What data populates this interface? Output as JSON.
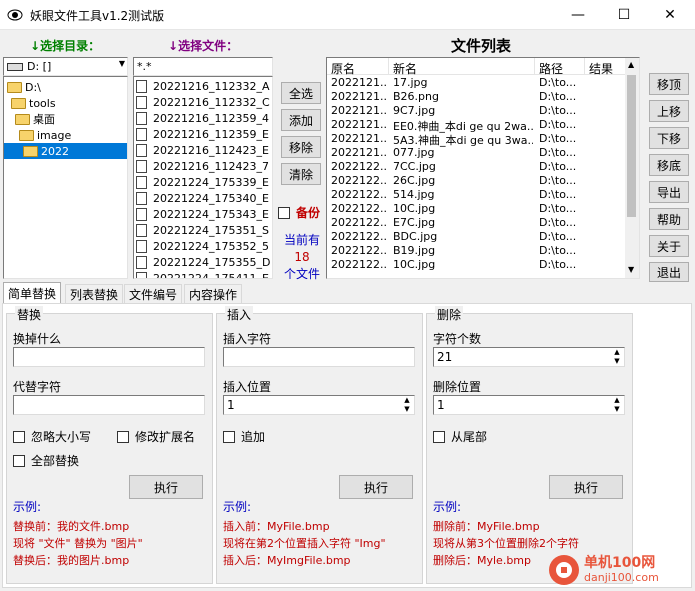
{
  "window": {
    "title": "妖眼文件工具v1.2测试版",
    "min": "—",
    "max": "☐",
    "close": "✕"
  },
  "labels": {
    "select_dir": "选择目录：",
    "select_file": "选择文件：",
    "file_list": "文件列表"
  },
  "drive": {
    "value": "D: []"
  },
  "tree": [
    "D:\\",
    "tools",
    "桌面",
    "image",
    "2022"
  ],
  "filter": {
    "value": "*.*"
  },
  "files": [
    "20221216_112332_A",
    "20221216_112332_C",
    "20221216_112359_4",
    "20221216_112359_E",
    "20221216_112423_E",
    "20221216_112423_7",
    "20221224_175339_E",
    "20221224_175340_E",
    "20221224_175343_E",
    "20221224_175351_S",
    "20221224_175352_5",
    "20221224_175355_D",
    "20221224_175411_E"
  ],
  "mid_buttons": {
    "select_all": "全选",
    "add": "添加",
    "remove": "移除",
    "clear": "清除"
  },
  "backup": {
    "label": "备份"
  },
  "count": {
    "line1": "当前有",
    "line2": "18",
    "line3": "个文件"
  },
  "table": {
    "headers": [
      "原名",
      "新名",
      "路径",
      "结果"
    ],
    "rows": [
      [
        "2022121...",
        "17.jpg",
        "D:\\to..."
      ],
      [
        "2022121...",
        "B26.png",
        "D:\\to..."
      ],
      [
        "2022121...",
        "9C7.jpg",
        "D:\\to..."
      ],
      [
        "2022121...",
        "EE0.神曲_本di ge qu 2wa...",
        "D:\\to..."
      ],
      [
        "2022121...",
        "5A3.神曲_本di ge qu 3wa...",
        "D:\\to..."
      ],
      [
        "2022121...",
        "077.jpg",
        "D:\\to..."
      ],
      [
        "2022122...",
        "7CC.jpg",
        "D:\\to..."
      ],
      [
        "2022122...",
        "26C.jpg",
        "D:\\to..."
      ],
      [
        "2022122...",
        "514.jpg",
        "D:\\to..."
      ],
      [
        "2022122...",
        "10C.jpg",
        "D:\\to..."
      ],
      [
        "2022122...",
        "E7C.jpg",
        "D:\\to..."
      ],
      [
        "2022122...",
        "BDC.jpg",
        "D:\\to..."
      ],
      [
        "2022122...",
        "B19.jpg",
        "D:\\to..."
      ],
      [
        "2022122...",
        "10C.jpg",
        "D:\\to..."
      ]
    ]
  },
  "right_buttons": {
    "top": "移顶",
    "up": "上移",
    "down": "下移",
    "bottom": "移底",
    "export": "导出",
    "help": "帮助",
    "about": "关于",
    "exit": "退出"
  },
  "tabs": [
    "简单替换",
    "列表替换",
    "文件编号",
    "内容操作"
  ],
  "replace": {
    "title": "替换",
    "find_label": "换掉什么",
    "find_value": "",
    "repl_label": "代替字符",
    "repl_value": "",
    "ignore_case": "忽略大小写",
    "change_ext": "修改扩展名",
    "replace_all": "全部替换",
    "exec": "执行",
    "example_label": "示例:",
    "ex1": "替换前：我的文件.bmp",
    "ex2": "现将 \"文件\" 替换为 \"图片\"",
    "ex3": "替换后：我的图片.bmp"
  },
  "insert": {
    "title": "插入",
    "chars_label": "插入字符",
    "chars_value": "",
    "pos_label": "插入位置",
    "pos_value": "1",
    "append": "追加",
    "exec": "执行",
    "example_label": "示例:",
    "ex1": "插入前：MyFile.bmp",
    "ex2": "现将在第2个位置插入字符 \"Img\"",
    "ex3": "插入后：MyImgFile.bmp"
  },
  "delete": {
    "title": "删除",
    "count_label": "字符个数",
    "count_value": "21",
    "pos_label": "删除位置",
    "pos_value": "1",
    "from_end": "从尾部",
    "exec": "执行",
    "example_label": "示例:",
    "ex1": "删除前：MyFile.bmp",
    "ex2": "现将从第3个位置删除2个字符",
    "ex3": "删除后：Myle.bmp"
  },
  "watermark": {
    "cn": "单机100网",
    "url": "danji100.com"
  },
  "colors": {
    "green": "#008000",
    "purple": "#800080",
    "red": "#c00000",
    "blue": "#0000c0",
    "selection": "#0078d7"
  }
}
